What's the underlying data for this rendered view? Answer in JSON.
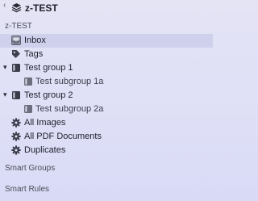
{
  "header": {
    "collapse_glyph": "‹",
    "title": "z-TEST"
  },
  "sidebar": {
    "section_label": "z-TEST",
    "items": [
      {
        "label": "Inbox",
        "icon": "inbox-icon",
        "selected": true
      },
      {
        "label": "Tags",
        "icon": "tag-icon"
      },
      {
        "label": "Test group 1",
        "icon": "group-icon",
        "disclosure": "▾"
      },
      {
        "label": "Test subgroup 1a",
        "icon": "group-icon"
      },
      {
        "label": "Test group 2",
        "icon": "group-icon",
        "disclosure": "▾"
      },
      {
        "label": "Test subgroup 2a",
        "icon": "group-icon"
      },
      {
        "label": "All Images",
        "icon": "gear-icon"
      },
      {
        "label": "All PDF Documents",
        "icon": "gear-icon"
      },
      {
        "label": "Duplicates",
        "icon": "gear-icon"
      }
    ],
    "smart_groups_label": "Smart Groups",
    "smart_rules_label": "Smart Rules"
  },
  "colors": {
    "selected_row": "#cfd0ec",
    "text": "#1e1f2b"
  }
}
